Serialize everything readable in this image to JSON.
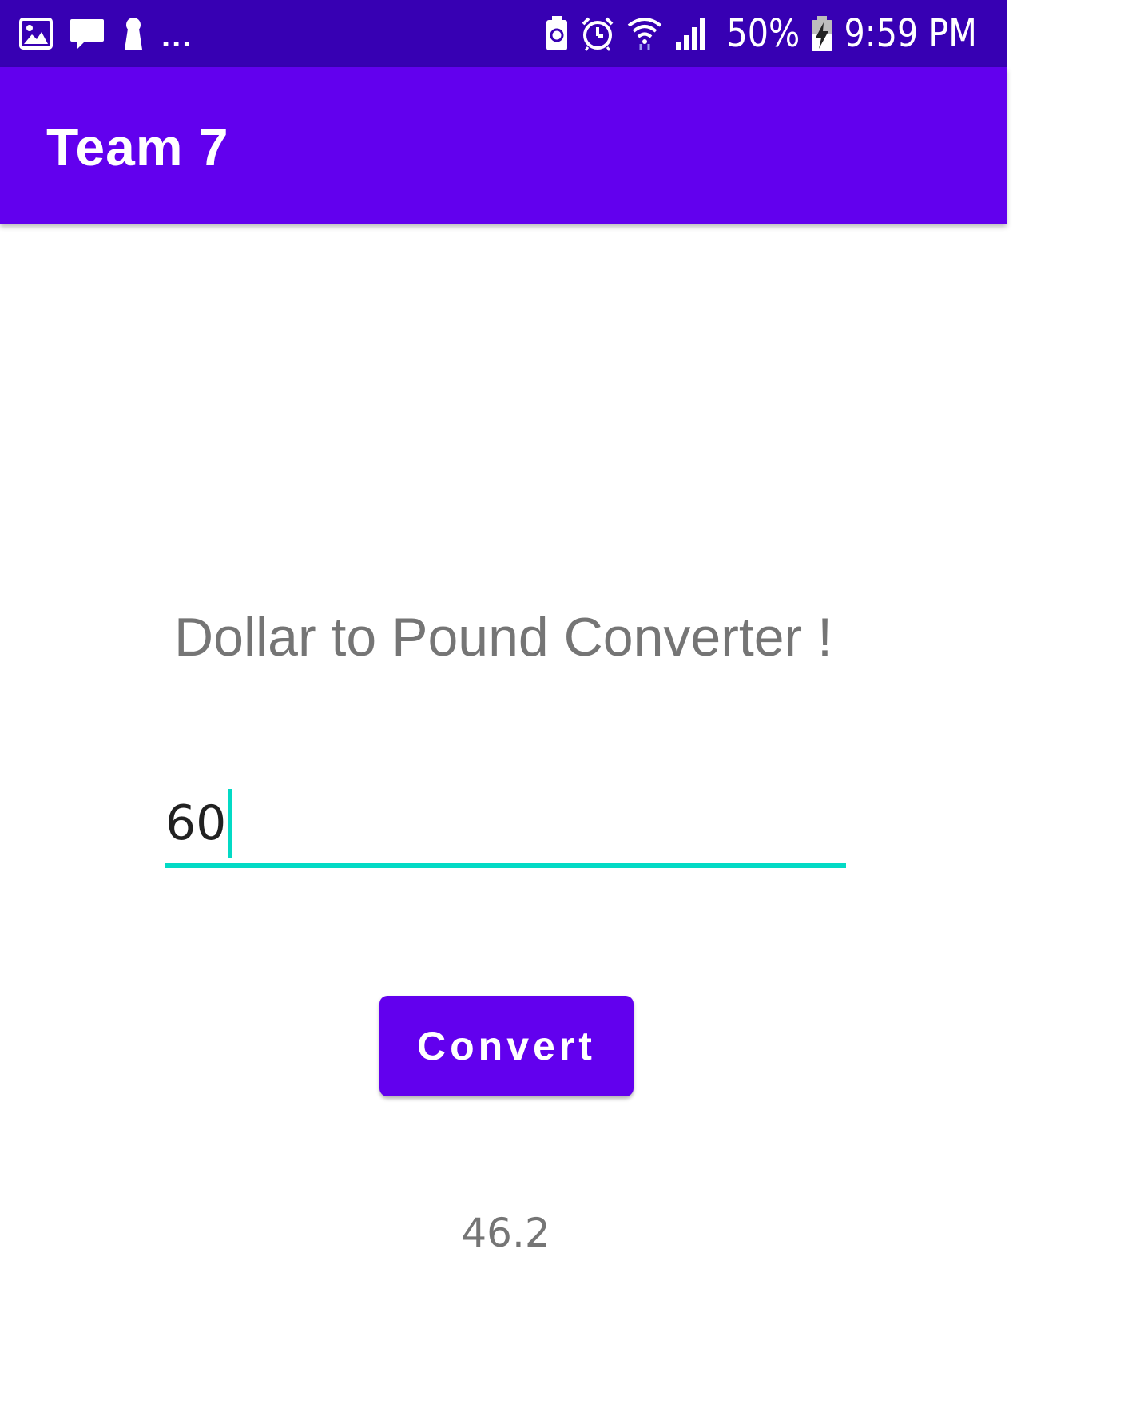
{
  "status_bar": {
    "left_icons": [
      "image-icon",
      "chat-icon",
      "keyhole-icon"
    ],
    "overflow": "...",
    "right_icons": [
      "battery-saver-icon",
      "alarm-icon",
      "wifi-icon",
      "signal-icon",
      "battery-charging-icon"
    ],
    "battery_percent": "50%",
    "time": "9:59 PM",
    "background_color": "#3700B3"
  },
  "app_bar": {
    "title": "Team 7",
    "background_color": "#6200EE"
  },
  "main": {
    "heading": "Dollar to Pound Converter !",
    "amount_input": {
      "value": "60",
      "accent_color": "#03DAC5"
    },
    "convert_button": {
      "label": "Convert"
    },
    "result": "46.2"
  }
}
